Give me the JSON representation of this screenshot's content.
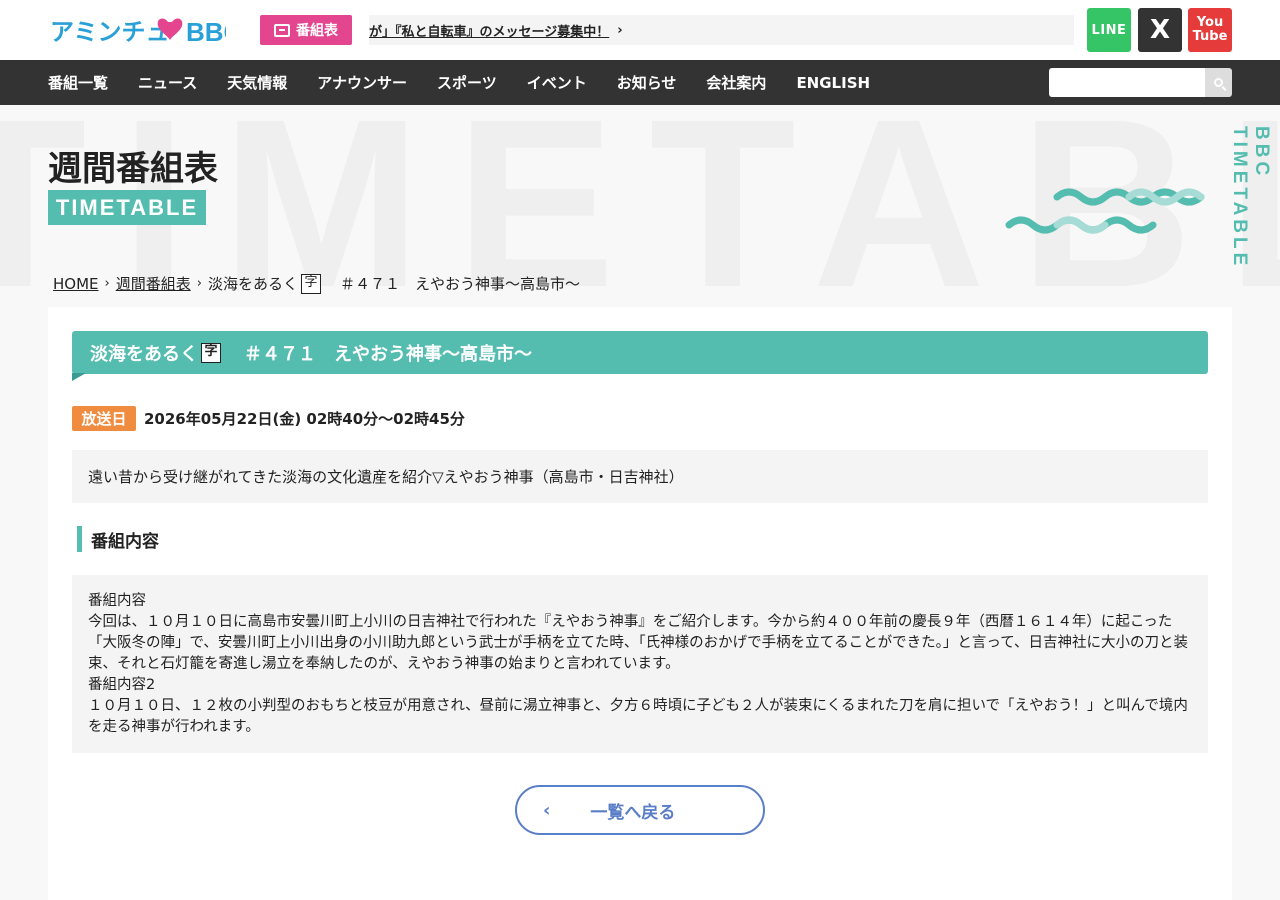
{
  "header": {
    "logo_alt": "アミンチュ BBC",
    "program_button": "番組表",
    "ticker": "が」『私と自転車』のメッセージ募集中！",
    "sns": {
      "line": "LINE",
      "x": "X",
      "youtube_line1": "You",
      "youtube_line2": "Tube"
    }
  },
  "nav": {
    "items": [
      "番組一覧",
      "ニュース",
      "天気情報",
      "アナウンサー",
      "スポーツ",
      "イベント",
      "お知らせ",
      "会社案内",
      "ENGLISH"
    ],
    "search_placeholder": ""
  },
  "hero": {
    "bg_text": "TIMETABLE T",
    "title": "週間番組表",
    "badge": "TIMETABLE",
    "side_label": "BBC TIMETABLE"
  },
  "breadcrumb": {
    "home": "HOME",
    "timetable": "週間番組表",
    "current_prefix": "淡海をあるく",
    "current_cap": "字",
    "current_suffix": "＃４７１　えやおう神事〜高島市〜"
  },
  "program": {
    "title_prefix": "淡海をあるく",
    "title_cap": "字",
    "title_suffix": "＃４７１　えやおう神事〜高島市〜",
    "air_badge": "放送日",
    "air_date": "2026年05月22日(金) 02時40分〜02時45分",
    "summary": "遠い昔から受け継がれてきた淡海の文化遺産を紹介▽えやおう神事（高島市・日吉神社）",
    "section_title": "番組内容",
    "content_lines": [
      "番組内容",
      "今回は、１０月１０日に高島市安曇川町上小川の日吉神社で行われた『えやおう神事』をご紹介します。今から約４００年前の慶長９年（西暦１６１４年）に起こった「大阪冬の陣」で、安曇川町上小川出身の小川助九郎という武士が手柄を立てた時、「氏神様のおかげで手柄を立てることができた。」と言って、日吉神社に大小の刀と装束、それと石灯籠を寄進し湯立を奉納したのが、えやおう神事の始まりと言われています。",
      "番組内容2",
      "１０月１０日、１２枚の小判型のおもちと枝豆が用意され、昼前に湯立神事と、夕方６時頃に子ども２人が装束にくるまれた刀を肩に担いで「えやおう！」と叫んで境内を走る神事が行われます。"
    ],
    "back_button": "一覧へ戻る"
  },
  "colors": {
    "accent_teal": "#55bcb0",
    "program_pink": "#e4458f",
    "air_orange": "#ef8c3f",
    "line_green": "#35c466",
    "youtube_red": "#e63b3b",
    "nav_dark": "#333333",
    "back_blue": "#5a7ec7"
  },
  "icons": [
    "tv-icon",
    "chevron-right-icon",
    "search-icon",
    "chevron-left-icon",
    "wave-decoration"
  ]
}
